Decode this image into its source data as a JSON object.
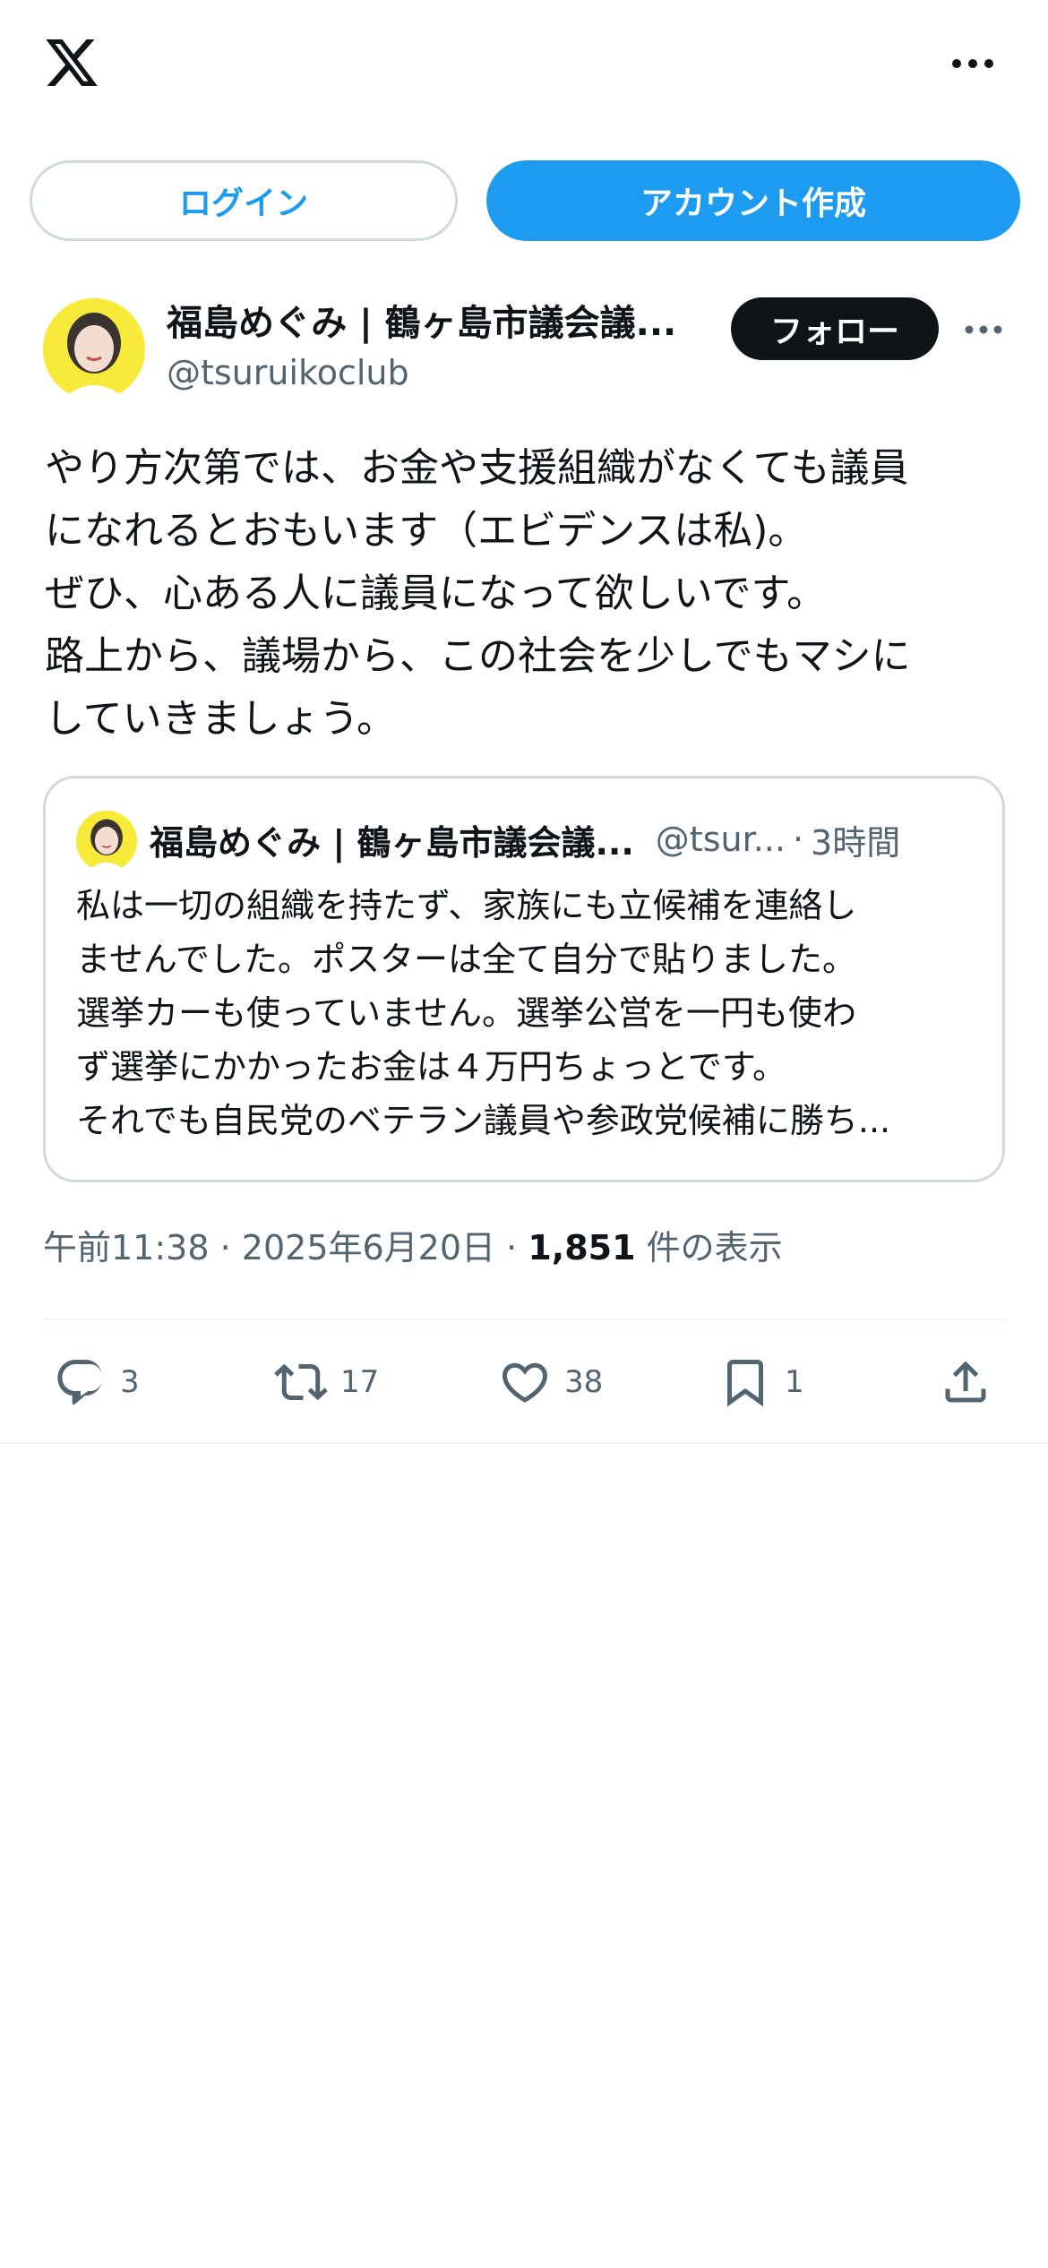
{
  "header": {
    "logo_icon": "x-logo-icon",
    "more_icon": "more-horizontal-icon"
  },
  "auth": {
    "login_label": "ログイン",
    "signup_label": "アカウント作成"
  },
  "post": {
    "author_name": "福島めぐみ | 鶴ヶ島市議会議...",
    "author_handle": "@tsuruikoclub",
    "follow_label": "フォロー",
    "text": "やり方次第では、お金や支援組織がなくても議員\nになれるとおもいます（エビデンスは私)。\nぜひ、心ある人に議員になって欲しいです。\n路上から、議場から、この社会を少しでもマシに\nしていきましょう。",
    "time": "午前11:38",
    "date": "2025年6月20日",
    "views": "1,851",
    "views_label": "件の表示",
    "separator": "·"
  },
  "quote": {
    "author_name": "福島めぐみ | 鶴ヶ島市議会議...",
    "author_handle": "@tsur...",
    "separator": "·",
    "time": "3時間",
    "text": "私は一切の組織を持たず、家族にも立候補を連絡し\nませんでした。ポスターは全て自分で貼りました。\n選挙カーも使っていません。選挙公営を一円も使わ\nず選挙にかかったお金は４万円ちょっとです。\nそれでも自民党のベテラン議員や参政党候補に勝ち..."
  },
  "actions": {
    "reply_count": "3",
    "repost_count": "17",
    "like_count": "38",
    "bookmark_count": "1"
  },
  "colors": {
    "accent": "#1d9bf0",
    "text": "#0f1419",
    "secondary": "#536471",
    "border": "#cfd9de",
    "avatar_bg": "#f7ea3a"
  }
}
